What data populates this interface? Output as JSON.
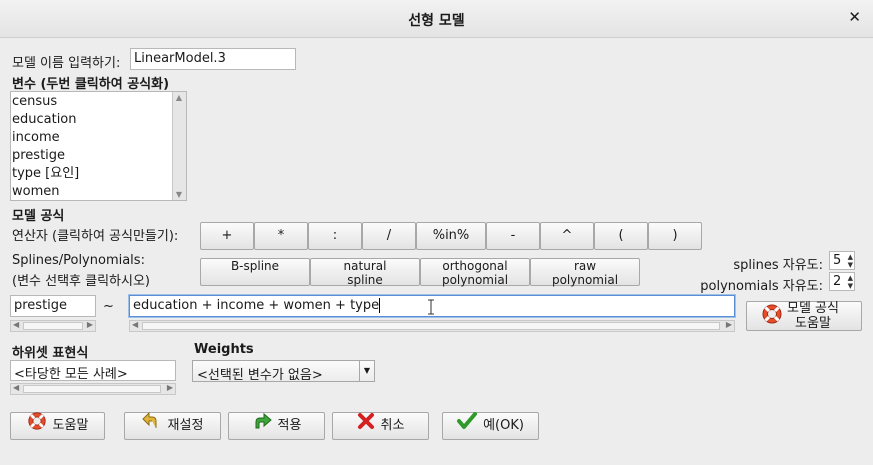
{
  "window": {
    "title": "선형 모델"
  },
  "model_name": {
    "label": "모델 이름 입력하기:",
    "value": "LinearModel.3"
  },
  "variables": {
    "label": "변수 (두번 클릭하여 공식화)",
    "items": [
      "census",
      "education",
      "income",
      "prestige",
      "type [요인]",
      "women"
    ]
  },
  "formula_section": {
    "label": "모델 공식"
  },
  "operators": {
    "label": "연산자 (클릭하여 공식만들기):",
    "buttons": [
      "+",
      "*",
      ":",
      "/",
      "%in%",
      "-",
      "^",
      "(",
      ")"
    ]
  },
  "splines": {
    "label_line1": "Splines/Polynomials:",
    "label_line2": "(변수 선택후 클릭하시오)",
    "buttons": [
      {
        "line1": "B-spline",
        "line2": ""
      },
      {
        "line1": "natural",
        "line2": "spline"
      },
      {
        "line1": "orthogonal",
        "line2": "polynomial"
      },
      {
        "line1": "raw",
        "line2": "polynomial"
      }
    ],
    "splines_df_label": "splines 자유도:",
    "splines_df_value": "5",
    "poly_df_label": "polynomials 자유도:",
    "poly_df_value": "2"
  },
  "formula": {
    "lhs": "prestige",
    "tilde": "~",
    "rhs": "education + income + women + type "
  },
  "formula_help": {
    "line1": "모델 공식",
    "line2": "도움말"
  },
  "subset": {
    "label": "하위셋 표현식",
    "value": "<타당한 모든 사례>"
  },
  "weights": {
    "label": "Weights",
    "value": "<선택된 변수가 없음>"
  },
  "buttons": {
    "help": "도움말",
    "reset": "재설정",
    "apply": "적용",
    "cancel": "취소",
    "ok": "예(OK)"
  },
  "icons": {
    "help": "lifebuoy-icon",
    "reset": "undo-arrow-icon",
    "apply": "redo-arrow-icon",
    "cancel": "red-x-icon",
    "ok": "green-check-icon"
  }
}
